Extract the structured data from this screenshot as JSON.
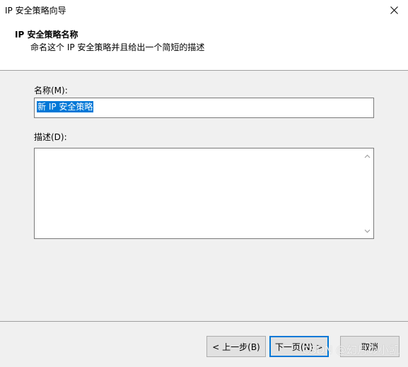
{
  "window": {
    "title": "IP 安全策略向导"
  },
  "header": {
    "title": "IP 安全策略名称",
    "subtitle": "命名这个 IP 安全策略并且给出一个简短的描述"
  },
  "form": {
    "name_label": "名称(M):",
    "name_value": "新 IP 安全策略",
    "desc_label": "描述(D):",
    "desc_value": ""
  },
  "buttons": {
    "back": "< 上一步(B)",
    "next": "下一页(N) >",
    "cancel": "取消"
  },
  "watermark": "CSDN @幻月の小凯",
  "colors": {
    "selection": "#0078d7",
    "background": "#f0f0f0"
  }
}
